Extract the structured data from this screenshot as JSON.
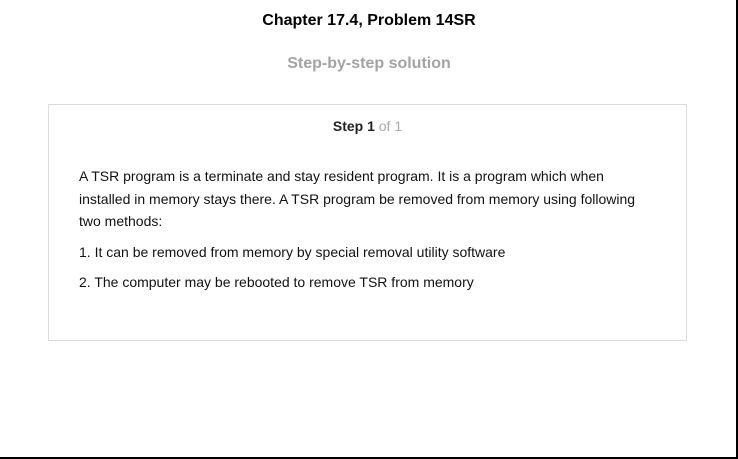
{
  "header": {
    "title": "Chapter 17.4, Problem 14SR",
    "subtitle": "Step-by-step solution"
  },
  "step": {
    "label": "Step 1",
    "count": "of 1",
    "paragraph": "A TSR program is a terminate and stay resident program. It is a program which when installed in memory stays there. A TSR program be removed from memory using following two methods:",
    "items": [
      "1. It can be removed from memory by special removal utility software",
      "2. The computer may be rebooted to remove TSR from memory"
    ]
  }
}
